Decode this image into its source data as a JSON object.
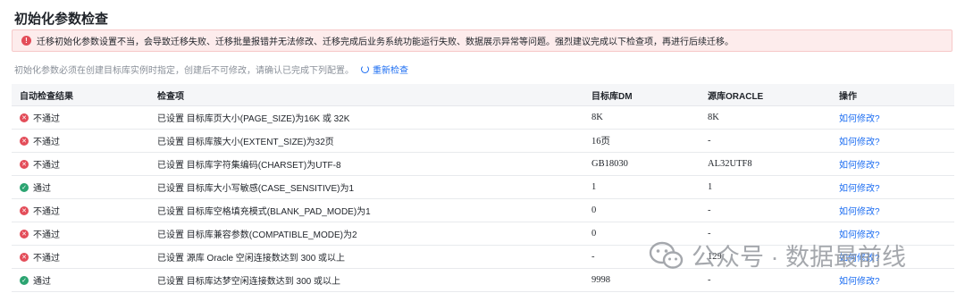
{
  "page": {
    "title": "初始化参数检查",
    "alert_text": "迁移初始化参数设置不当，会导致迁移失败、迁移批量报错并无法修改、迁移完成后业务系统功能运行失败、数据展示异常等问题。强烈建议完成以下检查项，再进行后续迁移。",
    "hint": "初始化参数必须在创建目标库实例时指定，创建后不可修改，请确认已完成下列配置。",
    "recheck_label": "重新检查"
  },
  "table": {
    "headers": [
      "自动检查结果",
      "检查项",
      "目标库DM",
      "源库ORACLE",
      "操作"
    ],
    "rows": [
      {
        "result": "不通过",
        "status": "fail",
        "item": "已设置 目标库页大小(PAGE_SIZE)为16K 或 32K",
        "dm": "8K",
        "oracle": "8K",
        "action": "如何修改?"
      },
      {
        "result": "不通过",
        "status": "fail",
        "item": "已设置 目标库簇大小(EXTENT_SIZE)为32页",
        "dm": "16页",
        "oracle": "-",
        "action": "如何修改?"
      },
      {
        "result": "不通过",
        "status": "fail",
        "item": "已设置 目标库字符集编码(CHARSET)为UTF-8",
        "dm": "GB18030",
        "oracle": "AL32UTF8",
        "action": "如何修改?"
      },
      {
        "result": "通过",
        "status": "pass",
        "item": "已设置 目标库大小写敏感(CASE_SENSITIVE)为1",
        "dm": "1",
        "oracle": "1",
        "action": "如何修改?"
      },
      {
        "result": "不通过",
        "status": "fail",
        "item": "已设置 目标库空格填充模式(BLANK_PAD_MODE)为1",
        "dm": "0",
        "oracle": "-",
        "action": "如何修改?"
      },
      {
        "result": "不通过",
        "status": "fail",
        "item": "已设置 目标库兼容参数(COMPATIBLE_MODE)为2",
        "dm": "0",
        "oracle": "-",
        "action": "如何修改?"
      },
      {
        "result": "不通过",
        "status": "fail",
        "item": "已设置 源库 Oracle 空闲连接数达到 300 或以上",
        "dm": "-",
        "oracle": "129",
        "action": "如何修改?"
      },
      {
        "result": "通过",
        "status": "pass",
        "item": "已设置 目标库达梦空闲连接数达到 300 或以上",
        "dm": "9998",
        "oracle": "-",
        "action": "如何修改?"
      }
    ]
  },
  "watermark": {
    "text": "公众号 · 数据最前线",
    "icon": "wechat-icon"
  },
  "colors": {
    "fail": "#e34d59",
    "pass": "#2ba471",
    "link": "#1d6ef2",
    "alert_bg": "#fdecec"
  }
}
